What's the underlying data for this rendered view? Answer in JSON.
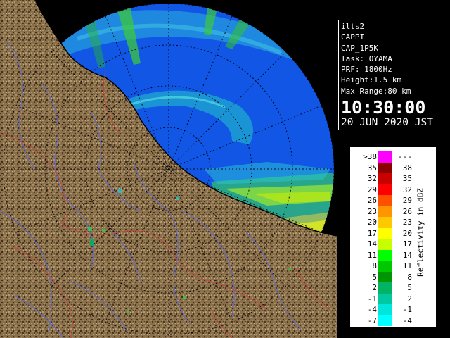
{
  "info": {
    "product_id": "ilts2",
    "product_type": "CAPPI",
    "product_name": "CAP_1P5K",
    "task": "Task: OYAMA",
    "prf": "PRF: 1800Hz",
    "height": "Height:1.5 km",
    "max_range": "Max Range:80 km",
    "time": "10:30:00",
    "date": "20 JUN 2020 JST"
  },
  "legend": {
    "title": "Reflectivity in dBZ",
    "rows": [
      {
        "lo": ">38",
        "hi": "---",
        "color": "#ff00ff"
      },
      {
        "lo": "35",
        "hi": "38",
        "color": "#8c0000"
      },
      {
        "lo": "32",
        "hi": "35",
        "color": "#c80000"
      },
      {
        "lo": "29",
        "hi": "32",
        "color": "#ff0000"
      },
      {
        "lo": "26",
        "hi": "29",
        "color": "#ff5000"
      },
      {
        "lo": "23",
        "hi": "26",
        "color": "#ff9600"
      },
      {
        "lo": "20",
        "hi": "23",
        "color": "#ffc800"
      },
      {
        "lo": "17",
        "hi": "20",
        "color": "#ffff00"
      },
      {
        "lo": "14",
        "hi": "17",
        "color": "#c8ff00"
      },
      {
        "lo": "11",
        "hi": "14",
        "color": "#00ff00"
      },
      {
        "lo": "8",
        "hi": "11",
        "color": "#00c800"
      },
      {
        "lo": "5",
        "hi": "8",
        "color": "#009600"
      },
      {
        "lo": "2",
        "hi": "5",
        "color": "#00b464"
      },
      {
        "lo": "-1",
        "hi": "2",
        "color": "#00c8a0"
      },
      {
        "lo": "-4",
        "hi": "-1",
        "color": "#00e6dc"
      },
      {
        "lo": "-7",
        "hi": "-4",
        "color": "#00ffff"
      }
    ]
  },
  "colors": {
    "sea_background": "#1256e6",
    "land": "#8a6f4b",
    "land_dark": "#4a3520",
    "rivers": "#5a6adc",
    "boundaries": "#c84040",
    "range_rings": "#000000"
  }
}
